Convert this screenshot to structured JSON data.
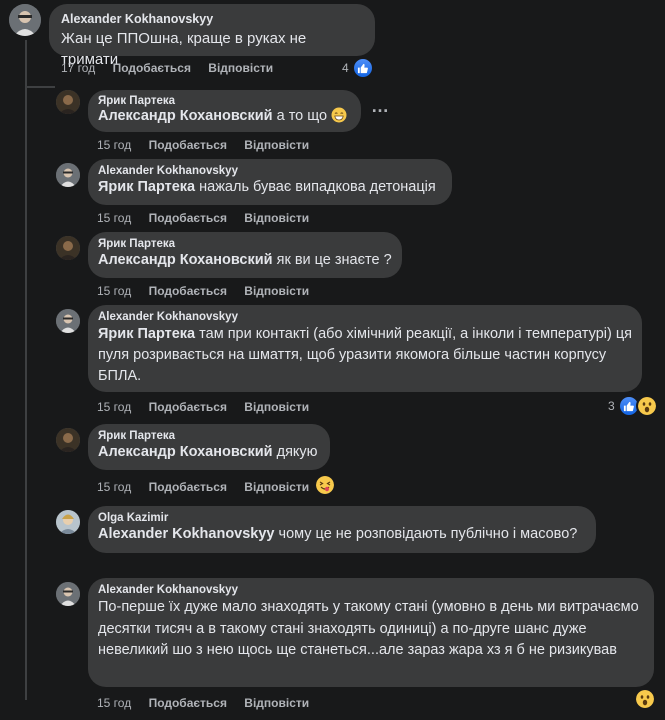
{
  "comments": [
    {
      "author": "Alexander Kokhanovskyy",
      "mention": "",
      "text": "Жан це ППОшна, краще в руках не тримати",
      "time": "17 год",
      "like": "Подобається",
      "reply": "Відповісти",
      "reactions": {
        "count": "4",
        "icons": [
          "like-icon"
        ]
      }
    },
    {
      "author": "Ярик Партека",
      "mention": "Александр Кохановский",
      "text": " а то що",
      "emoji": "grinning-face-emoji",
      "time": "15 год",
      "like": "Подобається",
      "reply": "Відповісти",
      "more": "…"
    },
    {
      "author": "Alexander Kokhanovskyy",
      "mention": "Ярик Партека",
      "text": " нажаль буває випадкова детонація",
      "time": "15 год",
      "like": "Подобається",
      "reply": "Відповісти"
    },
    {
      "author": "Ярик Партека",
      "mention": "Александр Кохановский",
      "text": " як ви це знаєте ?",
      "time": "15 год",
      "like": "Подобається",
      "reply": "Відповісти"
    },
    {
      "author": "Alexander Kokhanovskyy",
      "mention": "Ярик Партека",
      "text": " там при контакті (або хімічний реакції, а інколи і температурі) ця пуля розривається на шмаття, щоб уразити якомога більше частин корпусу БПЛА.",
      "time": "15 год",
      "like": "Подобається",
      "reply": "Відповісти",
      "reactions": {
        "count": "3",
        "icons": [
          "like-icon",
          "wow-icon"
        ]
      }
    },
    {
      "author": "Ярик Партека",
      "mention": "Александр Кохановский",
      "text": " дякую",
      "time": "15 год",
      "like": "Подобається",
      "reply": "Відповісти",
      "reactions": {
        "count": "",
        "icons": [
          "yum-icon"
        ]
      }
    },
    {
      "author": "Olga Kazimir",
      "mention": "Alexander Kokhanovskyy",
      "text": " чому це не розповідають публічно і масово?",
      "time": "",
      "like": "",
      "reply": ""
    },
    {
      "author": "Alexander Kokhanovskyy",
      "mention": "",
      "text": "По-перше їх дуже мало знаходять у такому стані (умовно в день ми витрачаємо десятки тисяч а в такому стані знаходять одиниці) а по-друге шанс дуже невеликий шо з нею щось ще станеться...але зараз жара хз я б не ризикував",
      "time": "15 год",
      "like": "Подобається",
      "reply": "Відповісти",
      "reactions": {
        "count": "",
        "icons": [
          "wow-icon"
        ]
      }
    }
  ]
}
